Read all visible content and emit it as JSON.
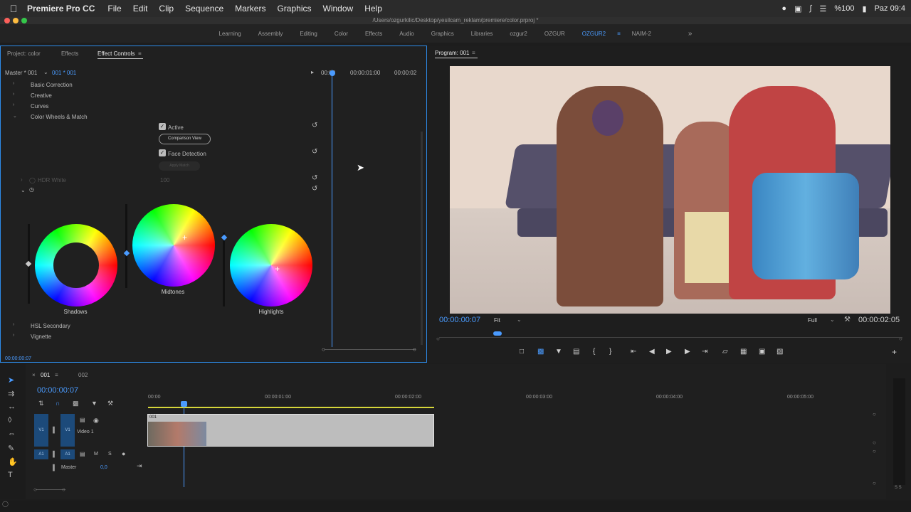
{
  "menubar": {
    "app_name": "Premiere Pro CC",
    "items": [
      "File",
      "Edit",
      "Clip",
      "Sequence",
      "Markers",
      "Graphics",
      "Window",
      "Help"
    ],
    "battery": "%100",
    "clock": "Paz 09:4"
  },
  "window": {
    "path": "/Users/ozgurkilic/Desktop/yesilcam_reklam/premiere/color.prproj *"
  },
  "workspaces": {
    "items": [
      "Learning",
      "Assembly",
      "Editing",
      "Color",
      "Effects",
      "Audio",
      "Graphics",
      "Libraries",
      "ozgur2",
      "OZGUR",
      "OZGUR2",
      "NAIM-2"
    ],
    "active": "OZGUR2"
  },
  "effect_panel": {
    "tabs": [
      "Project: color",
      "Effects",
      "Effect Controls"
    ],
    "master": "Master * 001",
    "sequence": "001 * 001",
    "ruler": [
      "00:00",
      "00:00:01:00",
      "00:00:02"
    ],
    "sections": [
      "Basic Correction",
      "Creative",
      "Curves",
      "Color Wheels & Match"
    ],
    "active_label": "Active",
    "comparison_label": "Comparison View",
    "face_label": "Face Detection",
    "apply_label": "Apply Match",
    "hdr_label": "HDR White",
    "hdr_value": "100",
    "wheels": [
      "Shadows",
      "Midtones",
      "Highlights"
    ],
    "bottom_sections": [
      "HSL Secondary",
      "Vignette"
    ],
    "timecode": "00:00:00:07"
  },
  "program": {
    "title": "Program: 001",
    "timecode": "00:00:00:07",
    "fit": "Fit",
    "quality": "Full",
    "duration": "00:00:02:05"
  },
  "timeline": {
    "tabs": [
      "001",
      "002"
    ],
    "timecode": "00:00:00:07",
    "ruler": [
      "00:00",
      "00:00:01:00",
      "00:00:02:00",
      "00:00:03:00",
      "00:00:04:00",
      "00:00:05:00"
    ],
    "video_track": "Video 1",
    "v_label": "V1",
    "a_label": "A1",
    "master_label": "Master",
    "master_value": "0,0",
    "clip_label": "001",
    "m_label": "M",
    "s_label": "S"
  },
  "meter": {
    "labels": "S S"
  }
}
